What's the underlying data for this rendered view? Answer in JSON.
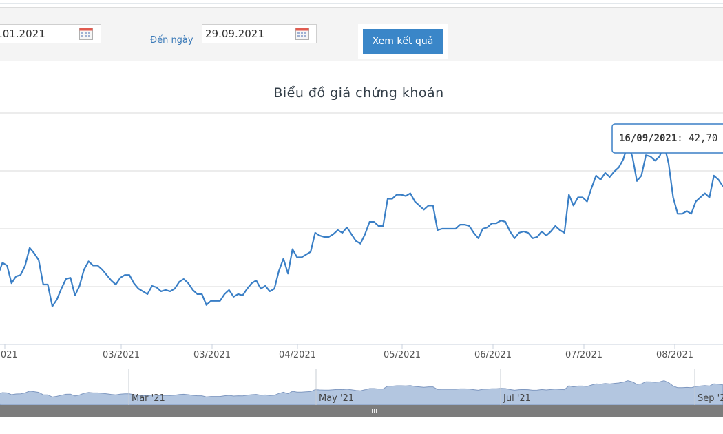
{
  "filter": {
    "from_value": ".01.2021",
    "to_label": "Đến ngày",
    "to_value": "29.09.2021",
    "submit_label": "Xem kết quả"
  },
  "colors": {
    "line": "#3a7fc6",
    "navigator_fill": "#b3c6e0",
    "button": "#3a86c8"
  },
  "chart_data": {
    "type": "line",
    "title": "Biểu đồ giá chứng khoán",
    "x_ticks": [
      "/2021",
      "03/2021",
      "03/2021",
      "04/2021",
      "05/2021",
      "06/2021",
      "07/2021",
      "08/2021"
    ],
    "navigator_labels": [
      "Mar '21",
      "May '21",
      "Jul '21",
      "Sep '2"
    ],
    "tooltip": {
      "date": "16/09/2021",
      "value": "42,70"
    },
    "y_gridlines": 4,
    "series": [
      {
        "values": [
          33.1,
          34.0,
          33.8,
          32.5,
          33.0,
          33.1,
          33.8,
          35.1,
          34.7,
          34.2,
          32.4,
          32.4,
          30.8,
          31.3,
          32.1,
          32.8,
          32.9,
          31.6,
          32.3,
          33.5,
          34.1,
          33.8,
          33.8,
          33.5,
          33.1,
          32.7,
          32.4,
          32.9,
          33.1,
          33.1,
          32.5,
          32.1,
          31.9,
          31.7,
          32.3,
          32.2,
          31.9,
          32.0,
          31.9,
          32.1,
          32.6,
          32.8,
          32.5,
          32.0,
          31.7,
          31.7,
          30.9,
          31.2,
          31.2,
          31.2,
          31.7,
          32.0,
          31.5,
          31.7,
          31.6,
          32.1,
          32.5,
          32.7,
          32.1,
          32.3,
          31.9,
          32.1,
          33.4,
          34.3,
          33.2,
          35.0,
          34.4,
          34.4,
          34.6,
          34.8,
          36.2,
          36.0,
          35.9,
          35.9,
          36.1,
          36.4,
          36.2,
          36.6,
          36.1,
          35.6,
          35.4,
          36.1,
          37.0,
          37.0,
          36.7,
          36.7,
          38.7,
          38.7,
          39.0,
          39.0,
          38.9,
          39.1,
          38.5,
          38.2,
          37.9,
          38.2,
          38.2,
          36.4,
          36.5,
          36.5,
          36.5,
          36.5,
          36.8,
          36.8,
          36.7,
          36.2,
          35.8,
          36.5,
          36.6,
          36.9,
          36.9,
          37.1,
          37.0,
          36.3,
          35.8,
          36.2,
          36.3,
          36.2,
          35.8,
          35.9,
          36.3,
          36.0,
          36.3,
          36.7,
          36.4,
          36.2,
          39.0,
          38.2,
          38.8,
          38.8,
          38.5,
          39.5,
          40.4,
          40.1,
          40.6,
          40.3,
          40.7,
          41.0,
          41.6,
          42.7,
          41.8,
          40.0,
          40.4,
          41.9,
          41.8,
          41.5,
          41.8,
          42.7,
          41.3,
          38.8,
          37.6,
          37.6,
          37.8,
          37.6,
          38.5,
          38.8,
          39.1,
          38.8,
          40.4,
          40.1,
          39.6
        ]
      }
    ]
  }
}
